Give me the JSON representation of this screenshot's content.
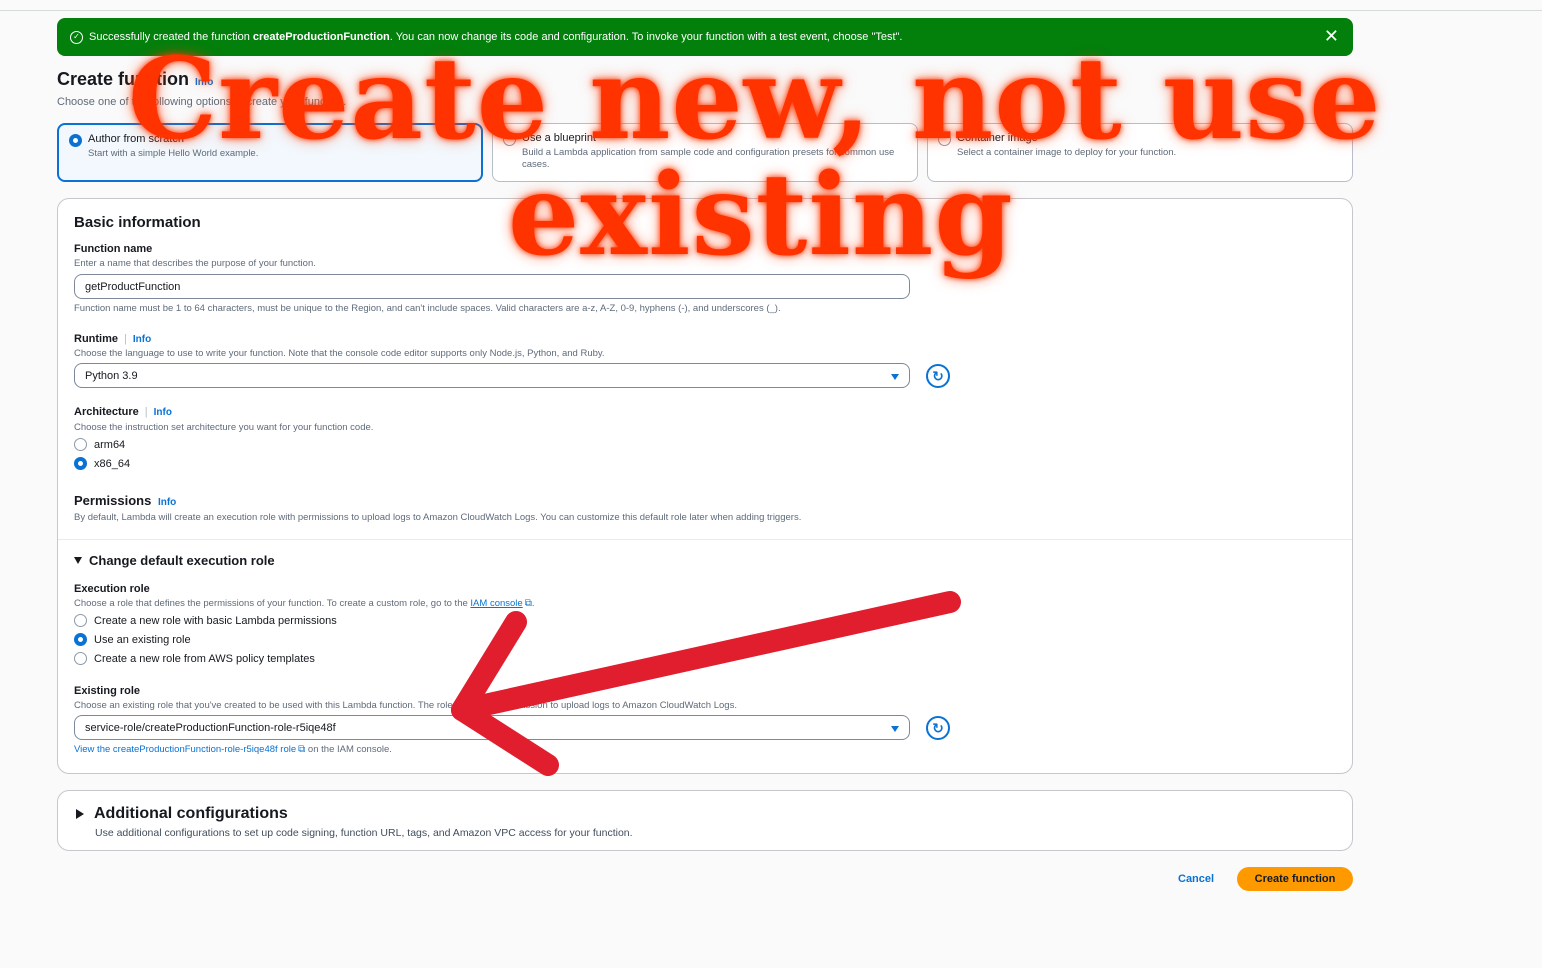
{
  "banner": {
    "prefix": "Successfully created the function ",
    "function_name": "createProductionFunction",
    "suffix": ". You can now change its code and configuration. To invoke your function with a test event, choose \"Test\"."
  },
  "page": {
    "title": "Create function",
    "info": "Info",
    "description": "Choose one of the following options to create your function."
  },
  "options": [
    {
      "title": "Author from scratch",
      "description": "Start with a simple Hello World example.",
      "selected": true
    },
    {
      "title": "Use a blueprint",
      "description": "Build a Lambda application from sample code and configuration presets for common use cases.",
      "selected": false
    },
    {
      "title": "Container image",
      "description": "Select a container image to deploy for your function.",
      "selected": false
    }
  ],
  "basic": {
    "title": "Basic information",
    "function_name_label": "Function name",
    "function_name_desc": "Enter a name that describes the purpose of your function.",
    "function_name_value": "getProductFunction",
    "function_name_hint": "Function name must be 1 to 64 characters, must be unique to the Region, and can't include spaces. Valid characters are a-z, A-Z, 0-9, hyphens (-), and underscores (_).",
    "runtime_label": "Runtime",
    "runtime_info": "Info",
    "runtime_desc": "Choose the language to use to write your function. Note that the console code editor supports only Node.js, Python, and Ruby.",
    "runtime_value": "Python 3.9",
    "arch_label": "Architecture",
    "arch_info": "Info",
    "arch_desc": "Choose the instruction set architecture you want for your function code.",
    "arch_options": [
      "arm64",
      "x86_64"
    ],
    "arch_selected": "x86_64",
    "perm_title": "Permissions",
    "perm_info": "Info",
    "perm_desc": "By default, Lambda will create an execution role with permissions to upload logs to Amazon CloudWatch Logs. You can customize this default role later when adding triggers."
  },
  "exec": {
    "expander": "Change default execution role",
    "role_label": "Execution role",
    "role_desc": "Choose a role that defines the permissions of your function. To create a custom role, go to the ",
    "iam_link": "IAM console",
    "role_options": [
      "Create a new role with basic Lambda permissions",
      "Use an existing role",
      "Create a new role from AWS policy templates"
    ],
    "role_selected": "Use an existing role",
    "existing_label": "Existing role",
    "existing_desc": "Choose an existing role that you've created to be used with this Lambda function. The role must have permission to upload logs to Amazon CloudWatch Logs.",
    "existing_value": "service-role/createProductionFunction-role-r5iqe48f",
    "view_link": "View the createProductionFunction-role-r5iqe48f role",
    "view_suffix": " on the IAM console."
  },
  "additional": {
    "title": "Additional configurations",
    "description": "Use additional configurations to set up code signing, function URL, tags, and Amazon VPC access for your function."
  },
  "footer": {
    "cancel": "Cancel",
    "create": "Create function"
  },
  "annotation": {
    "line1": "Create new, not use",
    "line2": "existing",
    "color": "#ff3300",
    "arrow_color": "#e01e2e"
  }
}
